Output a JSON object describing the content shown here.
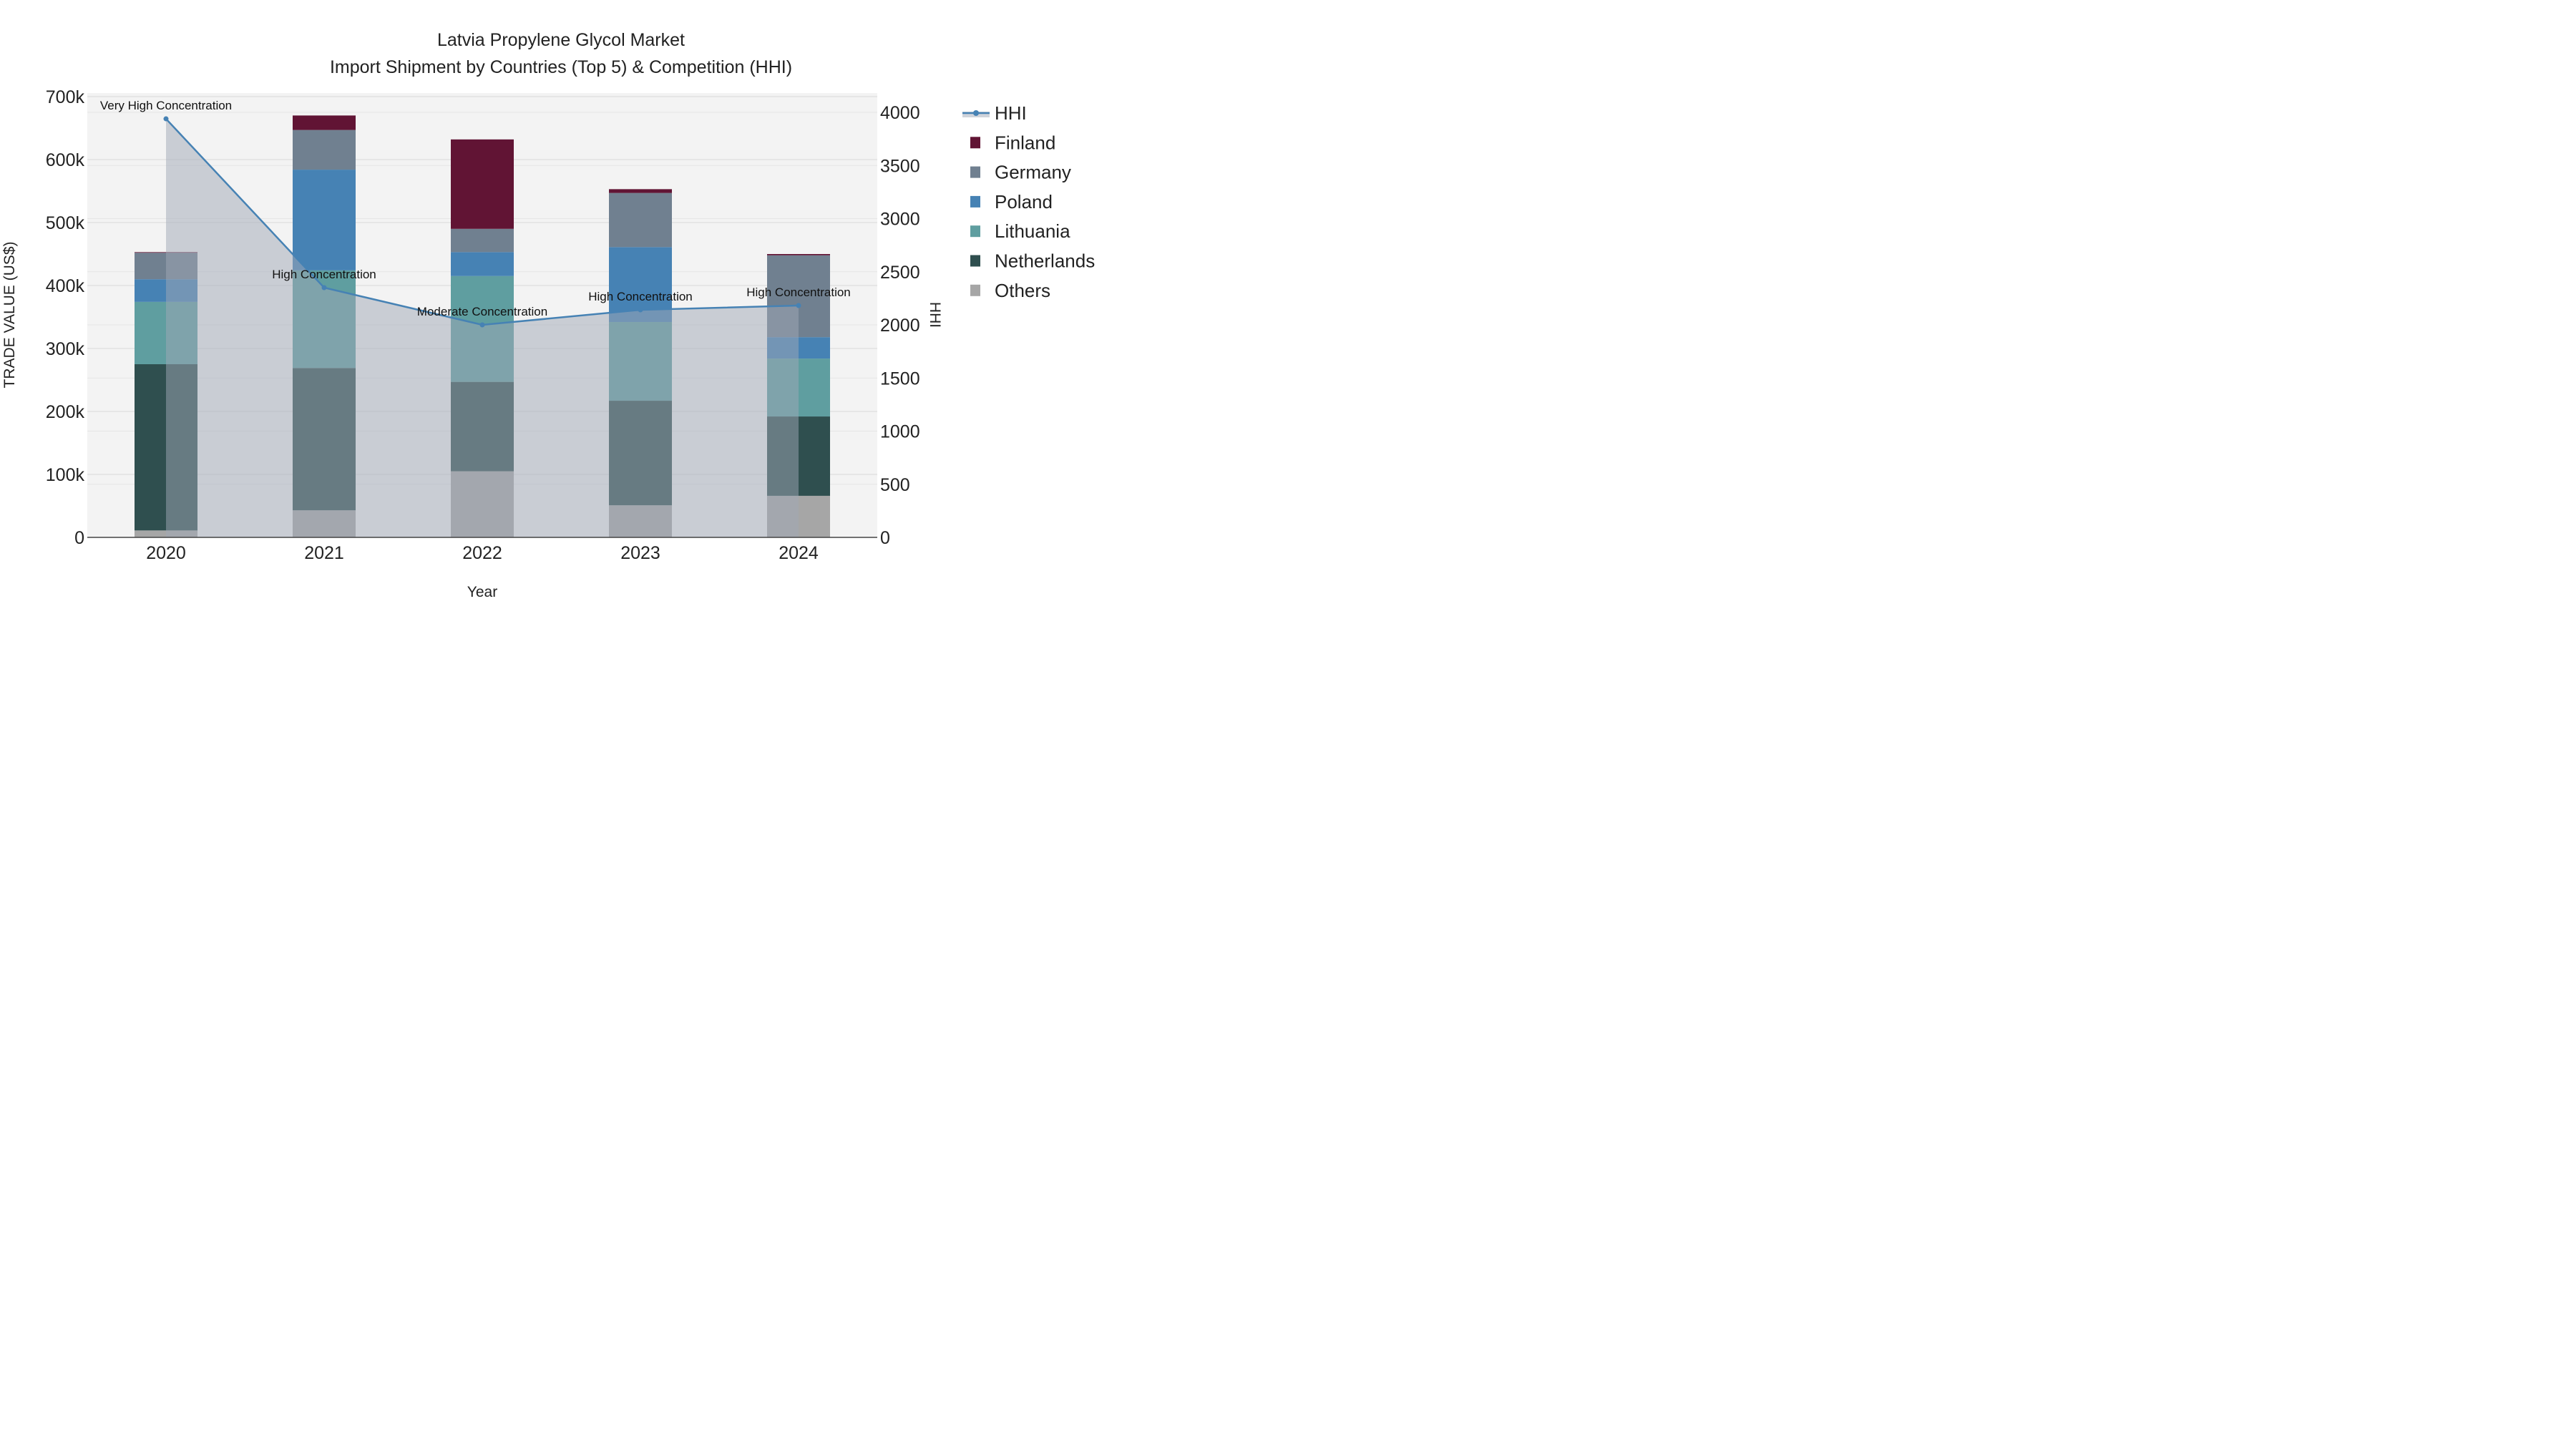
{
  "chart_data": {
    "type": "bar",
    "title": "Latvia Propylene Glycol Market",
    "subtitle": "Import Shipment by Countries (Top 5) & Competition (HHI)",
    "xlabel": "Year",
    "ylabel": "TRADE VALUE (US$)",
    "y2label": "HHI",
    "categories": [
      "2020",
      "2021",
      "2022",
      "2023",
      "2024"
    ],
    "ylim": [
      0,
      700000
    ],
    "y2lim": [
      0,
      4160
    ],
    "yticks": [
      "0",
      "100k",
      "200k",
      "300k",
      "400k",
      "500k",
      "600k",
      "700k"
    ],
    "y2ticks": [
      "0",
      "500",
      "1000",
      "1500",
      "2000",
      "2500",
      "3000",
      "3500",
      "4000"
    ],
    "series": [
      {
        "name": "Others",
        "color": "#a6a6a6",
        "values": [
          11000,
          43000,
          105000,
          51000,
          66000
        ]
      },
      {
        "name": "Netherlands",
        "color": "#2f4f4f",
        "values": [
          264000,
          226000,
          142000,
          166000,
          126000
        ]
      },
      {
        "name": "Lithuania",
        "color": "#5f9ea0",
        "values": [
          99000,
          155000,
          168000,
          125000,
          92000
        ]
      },
      {
        "name": "Poland",
        "color": "#4682b4",
        "values": [
          36000,
          160000,
          38000,
          119000,
          34000
        ]
      },
      {
        "name": "Germany",
        "color": "#708090",
        "values": [
          42000,
          63000,
          37000,
          86000,
          130000
        ]
      },
      {
        "name": "Finland",
        "color": "#611434",
        "values": [
          1000,
          23000,
          142000,
          6000,
          2000
        ]
      }
    ],
    "hhi": {
      "name": "HHI",
      "color": "#4682b4",
      "values": [
        3939,
        2350,
        2000,
        2141,
        2182
      ],
      "labels": [
        "Very High Concentration",
        "High Concentration",
        "Moderate Concentration",
        "High Concentration",
        "High Concentration"
      ]
    },
    "legend": [
      "HHI",
      "Finland",
      "Germany",
      "Poland",
      "Lithuania",
      "Netherlands",
      "Others"
    ],
    "legend_position": "right"
  }
}
